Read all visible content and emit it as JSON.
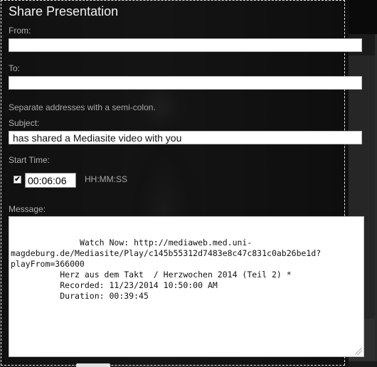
{
  "dialog": {
    "title": "Share Presentation",
    "from_label": "From:",
    "from_value": "",
    "to_label": "To:",
    "to_value": "",
    "separator_hint": "Separate addresses with a semi-colon.",
    "subject_label": "Subject:",
    "subject_value": "has shared a Mediasite video with you",
    "start_time_label": "Start Time:",
    "start_time_checked": true,
    "checkmark_glyph": "✔",
    "start_time_value": "00:06:06",
    "time_format": "HH:MM:SS",
    "message_label": "Message:",
    "message_value": "          Watch Now: http://mediaweb.med.uni-magdeburg.de/Mediasite/Play/c145b55312d7483e8c47c831c0ab26be1d?playFrom=366000\n          Herz aus dem Takt  / Herzwochen 2014 (Teil 2) *\n          Recorded: 11/23/2014 10:50:00 AM\n          Duration: 00:39:45"
  }
}
